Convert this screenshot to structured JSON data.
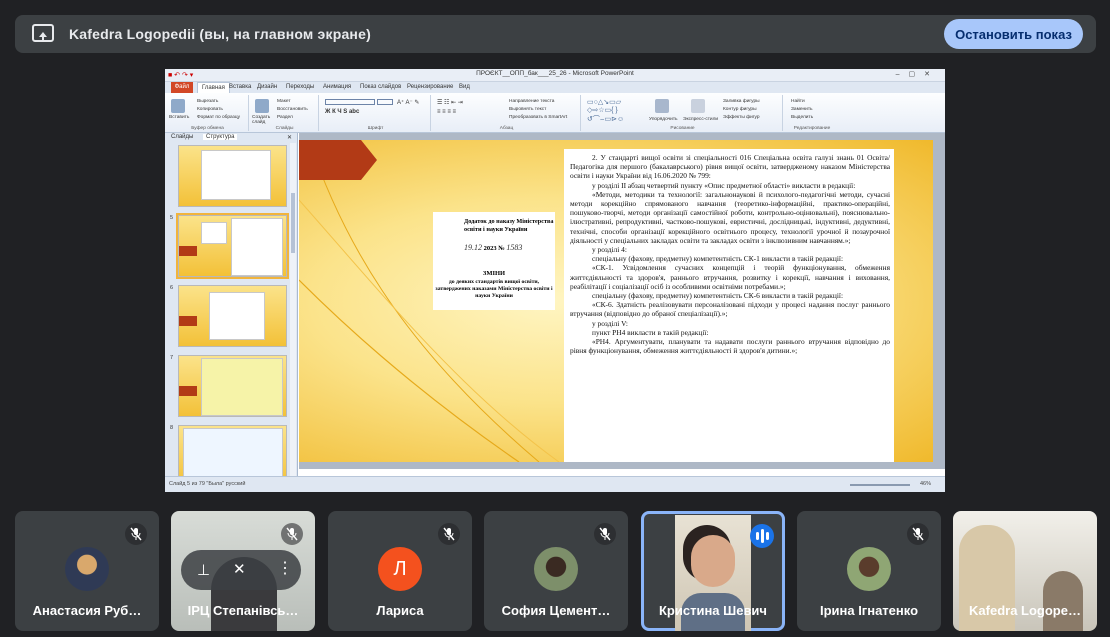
{
  "top_bar": {
    "presenter_title": "Kafedra Logopedii (вы, на главном экране)",
    "stop_button": "Остановить показ"
  },
  "ppt": {
    "window_title": "ПРОЄКТ__ОПП_бак___25_26 - Microsoft PowerPoint",
    "tabs": [
      "Файл",
      "Главная",
      "Вставка",
      "Дизайн",
      "Переходы",
      "Анимация",
      "Показ слайдов",
      "Рецензирование",
      "Вид"
    ],
    "ribbon": {
      "paste": "Вставить",
      "cut": "Вырезать",
      "copy": "Копировать",
      "format_painter": "Формат по образцу",
      "clipboard_group": "Буфер обмена",
      "new_slide": "Создать слайд",
      "layout": "Макет",
      "reset": "Восстановить",
      "section": "Раздел",
      "slides_group": "Слайды",
      "font_group": "Шрифт",
      "text_direction": "Направление текста",
      "align_text": "Выровнять текст",
      "smartart": "Преобразовать в SmartArt",
      "paragraph_group": "Абзац",
      "arrange": "Упорядочить",
      "quick_styles": "Экспресс-стили",
      "fill": "Заливка фигуры",
      "outline": "Контур фигуры",
      "effects": "Эффекты фигур",
      "drawing_group": "Рисование",
      "find": "Найти",
      "replace": "Заменить",
      "select": "Выделить",
      "editing_group": "Редактирование"
    },
    "pane_tabs": {
      "slides": "Слайды",
      "outline": "Структура"
    },
    "thumbnail_numbers": [
      "",
      "5",
      "6",
      "7",
      "8"
    ],
    "status": {
      "left": "Слайд 5 из 79   \"Была\"   русский",
      "zoom": "46%"
    }
  },
  "slide": {
    "order_header": "Додаток до наказу Міністерства освіти і науки України",
    "order_date_prefix": "",
    "order_date_handwritten": "19.12",
    "order_year_no": "2023 №",
    "order_number_handwritten": "1583",
    "changes_title": "ЗМІНИ",
    "changes_subtitle": "до деяких стандартів вищої освіти, затверджених наказами Міністерства освіти і науки України",
    "paragraphs": [
      "2. У стандарті вищої освіти зі спеціальності 016 Спеціальна освіта галузі знань 01 Освіта/Педагогіка для першого (бакалаврського) рівня вищої освіти, затвердженому наказом Міністерства освіти і науки України від 16.06.2020 № 799:",
      "у розділі ІІ абзац четвертий пункту «Опис предметної області» викласти в редакції:",
      "«Методи, методики та технології: загальнонаукові й психолого-педагогічні методи, сучасні методи корекційно спрямованого навчання (теоретико-інформаційні, практико-операційні, пошуково-творчі, методи організації самостійної роботи, контрольно-оцінювальні), пояснювально-ілюстративні, репродуктивні, частково-пошукові, евристичні, дослідницькі, індуктивні, дедуктивні, технічні, способи організації корекційного освітнього процесу, технології урочної й позаурочної діяльності у спеціальних закладах освіти та закладах освіти з інклюзивним навчанням.»;",
      "у розділі 4:",
      "спеціальну (фахову, предметну) компетентність СК-1 викласти в такій редакції:",
      "«СК-1. Усвідомлення сучасних концепцій і теорій функціонування, обмеження життєдіяльності та здоров'я, раннього втручання, розвитку і корекції, навчання і виховання, реабілітації і соціалізації осіб із особливими освітніми потребами.»;",
      "спеціальну (фахову, предметну) компетентність СК-6 викласти в такій редакції:",
      "«СК-6. Здатність реалізовувати персоналізовані підходи у процесі надання послуг раннього втручання (відповідно до обраної спеціалізації).»;",
      "у розділі V:",
      "пункт РН4 викласти в такій редакції:",
      "«РН4. Аргументувати, планувати та надавати послуги раннього втручання відповідно до рівня функціонування, обмеження життєдіяльності й здоров'я дитини.»;"
    ]
  },
  "participants": [
    {
      "name": "Анастасия Руб…",
      "muted": true,
      "avatar": "photo"
    },
    {
      "name": "ІРЦ Степанівсь…",
      "muted": true,
      "avatar": "video"
    },
    {
      "name": "Лариса",
      "muted": true,
      "avatar": "letter",
      "letter": "Л",
      "color": "#f4511e"
    },
    {
      "name": "София Цемент…",
      "muted": true,
      "avatar": "photo"
    },
    {
      "name": "Кристина Шевич",
      "muted": false,
      "speaking": true,
      "avatar": "video"
    },
    {
      "name": "Ірина Ігнатенко",
      "muted": true,
      "avatar": "photo"
    },
    {
      "name": "Kafedra Logope…",
      "muted": false,
      "avatar": "video"
    }
  ],
  "colors": {
    "background": "#202124",
    "tile": "#3c4043",
    "stop_button": "#a8c7fa",
    "active_outline": "#8ab4f8",
    "speaking": "#1a73e8"
  }
}
